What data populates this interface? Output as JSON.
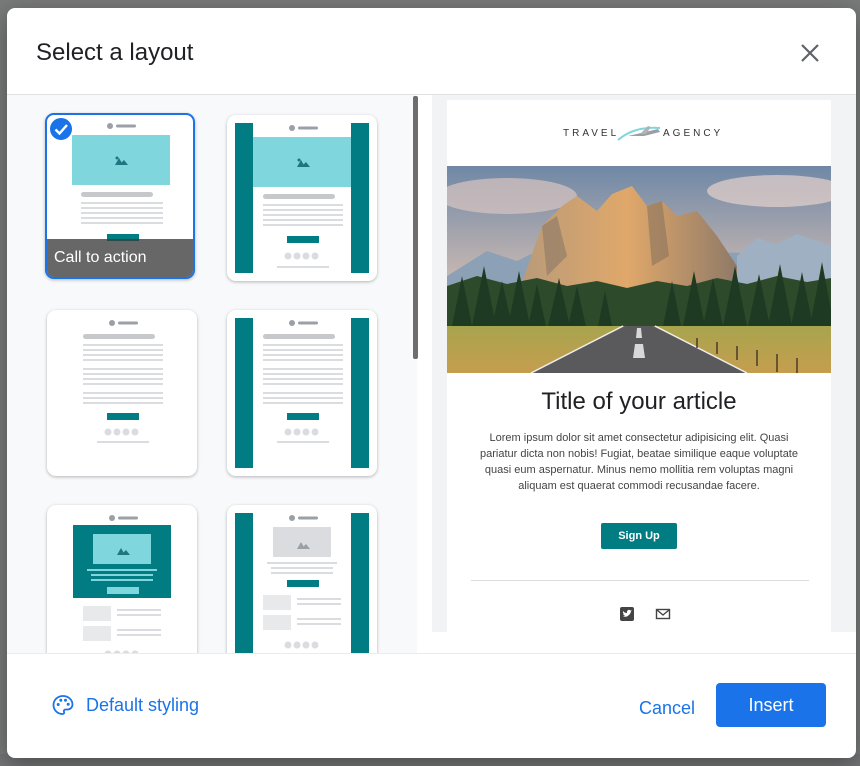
{
  "dialog": {
    "title": "Select a layout",
    "close_icon": "close-icon",
    "default_styling_label": "Default styling",
    "default_styling_icon": "palette-icon",
    "cancel_label": "Cancel",
    "insert_label": "Insert"
  },
  "layouts": [
    {
      "name": "Call to action",
      "selected": true
    },
    {
      "name": "",
      "selected": false
    },
    {
      "name": "",
      "selected": false
    },
    {
      "name": "",
      "selected": false
    },
    {
      "name": "",
      "selected": false
    },
    {
      "name": "",
      "selected": false
    }
  ],
  "preview": {
    "logo_left": "TRAVEL",
    "logo_right": "AGENCY",
    "title": "Title of your article",
    "body": "Lorem ipsum dolor sit amet consectetur adipisicing elit. Quasi pariatur dicta non nobis! Fugiat, beatae similique eaque voluptate quasi eum aspernatur. Minus nemo mollitia rem voluptas magni aliquam est quaerat commodi recusandae facere.",
    "button_label": "Sign Up",
    "social_icons": [
      "twitter-icon",
      "email-icon"
    ]
  },
  "colors": {
    "accent": "#1a73e8",
    "teal": "#007c82",
    "light_teal": "#7fd6dc"
  }
}
